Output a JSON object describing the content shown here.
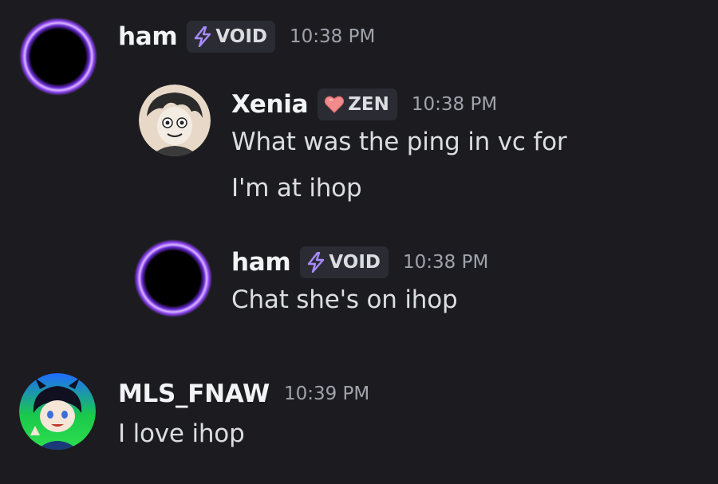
{
  "messages": [
    {
      "username": "ham",
      "tag": "VOID",
      "tag_icon": "lightning-icon",
      "time": "10:38 PM",
      "lines": []
    },
    {
      "username": "Xenia",
      "tag": "ZEN",
      "tag_icon": "heart-icon",
      "time": "10:38 PM",
      "lines": [
        "What was the ping in vc for",
        "I'm at ihop"
      ]
    },
    {
      "username": "ham",
      "tag": "VOID",
      "tag_icon": "lightning-icon",
      "time": "10:38 PM",
      "lines": [
        "Chat she's on ihop"
      ]
    },
    {
      "username": "MLS_FNAW",
      "time": "10:39 PM",
      "lines": [
        "I love ihop"
      ]
    }
  ],
  "colors": {
    "background": "#1c1c20",
    "username": "#f2f3f5",
    "message_text": "#dbdee1",
    "timestamp": "#a0a3ab",
    "tag_bg": "#2b2c33",
    "void_ring": "#b36bff",
    "zen_heart": "#f28b8b"
  }
}
